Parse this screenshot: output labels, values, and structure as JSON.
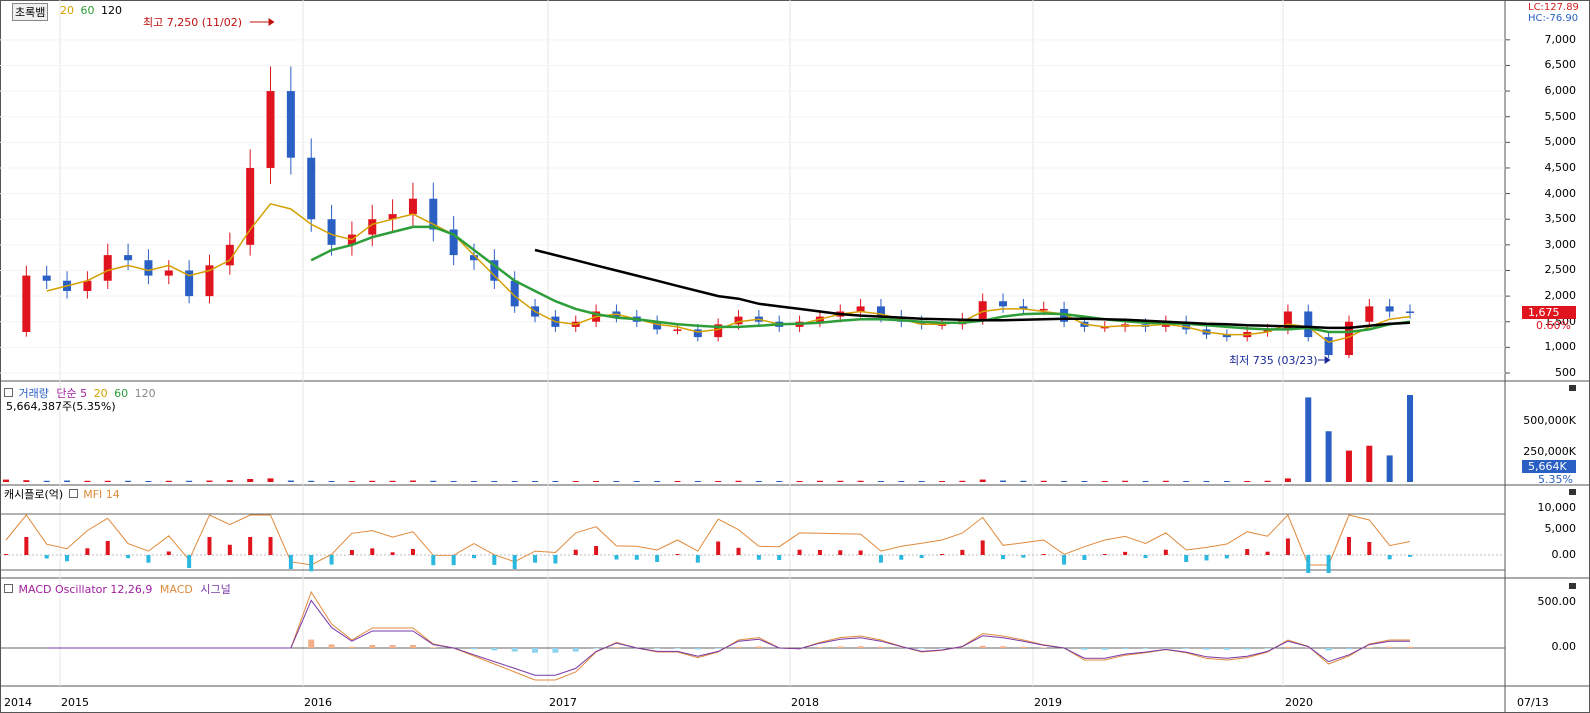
{
  "header": {
    "stock_name": "초록뱀",
    "ma_labels": [
      {
        "text": "20",
        "color": "#d4a000"
      },
      {
        "text": "60",
        "color": "#2e9e3a"
      },
      {
        "text": "120",
        "color": "#000000"
      }
    ],
    "lc": "LC:127.89",
    "hc": "HC:-76.90"
  },
  "annotations": {
    "high": "최고 7,250 (11/02)",
    "low": "최저 735 (03/23)"
  },
  "price_axis": {
    "ticks": [
      "7,000",
      "6,500",
      "6,000",
      "5,500",
      "5,000",
      "4,500",
      "4,000",
      "3,500",
      "3,000",
      "2,500",
      "2,000",
      "1,500",
      "1,000",
      "500"
    ],
    "current_price": "1,675",
    "current_change": "0.60%"
  },
  "volume_panel": {
    "label_main": "거래량",
    "label_type": "단순 5",
    "ma_labels": [
      "20",
      "60",
      "120"
    ],
    "current_value": "5,664,387주(5.35%)",
    "ticks": [
      "500,000K",
      "250,000K"
    ],
    "tag_value": "5,664K",
    "tag_pct": "5.35%"
  },
  "mfi_panel": {
    "label_main": "캐시플로(억)",
    "label_sub": "MFI 14",
    "ticks": [
      "10,000",
      "5,000",
      "0.00"
    ]
  },
  "macd_panel": {
    "label_osc": "MACD Oscillator 12,26,9",
    "label_macd": "MACD",
    "label_signal": "시그널",
    "ticks": [
      "500.00",
      "0.00"
    ]
  },
  "x_axis": {
    "labels": [
      "2014",
      "2015",
      "2016",
      "2017",
      "2018",
      "2019",
      "2020"
    ],
    "current_date": "07/13"
  },
  "colors": {
    "up": "#e0141e",
    "down": "#2a5fc4",
    "ma20": "#d4a000",
    "ma60": "#2e9e3a",
    "ma120": "#000000",
    "mfi": "#e08a3c",
    "macd": "#7a3aa8",
    "osc_pos": "#f2b08a",
    "osc_neg": "#8fd3ee",
    "cash_pos": "#e0141e",
    "cash_neg": "#2ab8de"
  },
  "chart_data": {
    "type": "candlestick",
    "title": "초록뱀",
    "x": [
      "2014-10",
      "2014-11",
      "2014-12",
      "2015-01",
      "2015-02",
      "2015-03",
      "2015-04",
      "2015-05",
      "2015-06",
      "2015-07",
      "2015-08",
      "2015-09",
      "2015-10",
      "2015-11",
      "2015-12",
      "2016-01",
      "2016-02",
      "2016-03",
      "2016-04",
      "2016-05",
      "2016-06",
      "2016-07",
      "2016-08",
      "2016-09",
      "2016-10",
      "2016-11",
      "2016-12",
      "2017-01",
      "2017-02",
      "2017-03",
      "2017-04",
      "2017-05",
      "2017-06",
      "2017-07",
      "2017-08",
      "2017-09",
      "2017-10",
      "2017-11",
      "2017-12",
      "2018-01",
      "2018-02",
      "2018-03",
      "2018-04",
      "2018-05",
      "2018-06",
      "2018-07",
      "2018-08",
      "2018-09",
      "2018-10",
      "2018-11",
      "2018-12",
      "2019-01",
      "2019-02",
      "2019-03",
      "2019-04",
      "2019-05",
      "2019-06",
      "2019-07",
      "2019-08",
      "2019-09",
      "2019-10",
      "2019-11",
      "2019-12",
      "2020-01",
      "2020-02",
      "2020-03",
      "2020-04",
      "2020-05",
      "2020-06",
      "2020-07"
    ],
    "close": [
      1300,
      2400,
      2300,
      2100,
      2300,
      2800,
      2700,
      2400,
      2500,
      2000,
      2600,
      3000,
      4500,
      6000,
      4700,
      3500,
      3000,
      3200,
      3500,
      3600,
      3900,
      3300,
      2800,
      2700,
      2300,
      1800,
      1600,
      1400,
      1500,
      1700,
      1600,
      1500,
      1350,
      1350,
      1200,
      1450,
      1600,
      1500,
      1400,
      1500,
      1600,
      1700,
      1800,
      1600,
      1500,
      1450,
      1450,
      1550,
      1900,
      1800,
      1750,
      1750,
      1500,
      1400,
      1400,
      1450,
      1400,
      1500,
      1350,
      1250,
      1200,
      1300,
      1350,
      1700,
      1200,
      850,
      1500,
      1800,
      1700,
      1675
    ],
    "ma": {
      "20": [
        null,
        null,
        2100,
        2200,
        2300,
        2500,
        2600,
        2500,
        2600,
        2400,
        2500,
        2700,
        3300,
        3800,
        3700,
        3400,
        3200,
        3100,
        3400,
        3500,
        3600,
        3400,
        3200,
        2800,
        2400,
        2000,
        1700,
        1500,
        1450,
        1600,
        1650,
        1550,
        1450,
        1400,
        1300,
        1350,
        1500,
        1550,
        1450,
        1450,
        1550,
        1650,
        1700,
        1650,
        1550,
        1450,
        1450,
        1500,
        1700,
        1750,
        1750,
        1700,
        1650,
        1450,
        1400,
        1420,
        1420,
        1450,
        1400,
        1300,
        1250,
        1250,
        1300,
        1450,
        1400,
        1100,
        1200,
        1400,
        1550,
        1600
      ],
      "60": [
        null,
        null,
        null,
        null,
        null,
        null,
        null,
        null,
        null,
        null,
        null,
        null,
        null,
        null,
        null,
        2700,
        2900,
        3000,
        3150,
        3250,
        3350,
        3350,
        3200,
        2900,
        2600,
        2300,
        2100,
        1900,
        1750,
        1650,
        1580,
        1550,
        1500,
        1450,
        1420,
        1400,
        1400,
        1420,
        1450,
        1460,
        1480,
        1520,
        1550,
        1550,
        1530,
        1500,
        1480,
        1480,
        1520,
        1600,
        1650,
        1660,
        1650,
        1600,
        1550,
        1510,
        1480,
        1470,
        1460,
        1430,
        1400,
        1370,
        1350,
        1350,
        1380,
        1300,
        1300,
        1350,
        1450,
        1500
      ],
      "120": [
        null,
        null,
        null,
        null,
        null,
        null,
        null,
        null,
        null,
        null,
        null,
        null,
        null,
        null,
        null,
        null,
        null,
        null,
        null,
        null,
        null,
        null,
        null,
        null,
        null,
        null,
        2900,
        2800,
        2700,
        2600,
        2500,
        2400,
        2300,
        2200,
        2100,
        2000,
        1950,
        1850,
        1800,
        1750,
        1700,
        1650,
        1620,
        1600,
        1580,
        1560,
        1550,
        1540,
        1530,
        1530,
        1540,
        1550,
        1560,
        1560,
        1550,
        1540,
        1520,
        1500,
        1480,
        1460,
        1450,
        1430,
        1420,
        1410,
        1400,
        1380,
        1380,
        1420,
        1460,
        1480
      ]
    },
    "volume_k": [
      20,
      15,
      10,
      12,
      10,
      10,
      10,
      8,
      10,
      10,
      12,
      15,
      25,
      30,
      12,
      10,
      8,
      8,
      10,
      10,
      12,
      10,
      8,
      8,
      8,
      8,
      6,
      6,
      6,
      6,
      8,
      8,
      6,
      6,
      6,
      8,
      10,
      8,
      8,
      8,
      10,
      10,
      10,
      8,
      8,
      8,
      8,
      10,
      20,
      12,
      10,
      10,
      8,
      8,
      8,
      10,
      8,
      10,
      8,
      6,
      6,
      8,
      10,
      30,
      700,
      420,
      260,
      300,
      220,
      5664
    ],
    "ylim": [
      500,
      7250
    ],
    "high": {
      "value": 7250,
      "date": "11/02"
    },
    "low": {
      "value": 735,
      "date": "03/23"
    }
  }
}
